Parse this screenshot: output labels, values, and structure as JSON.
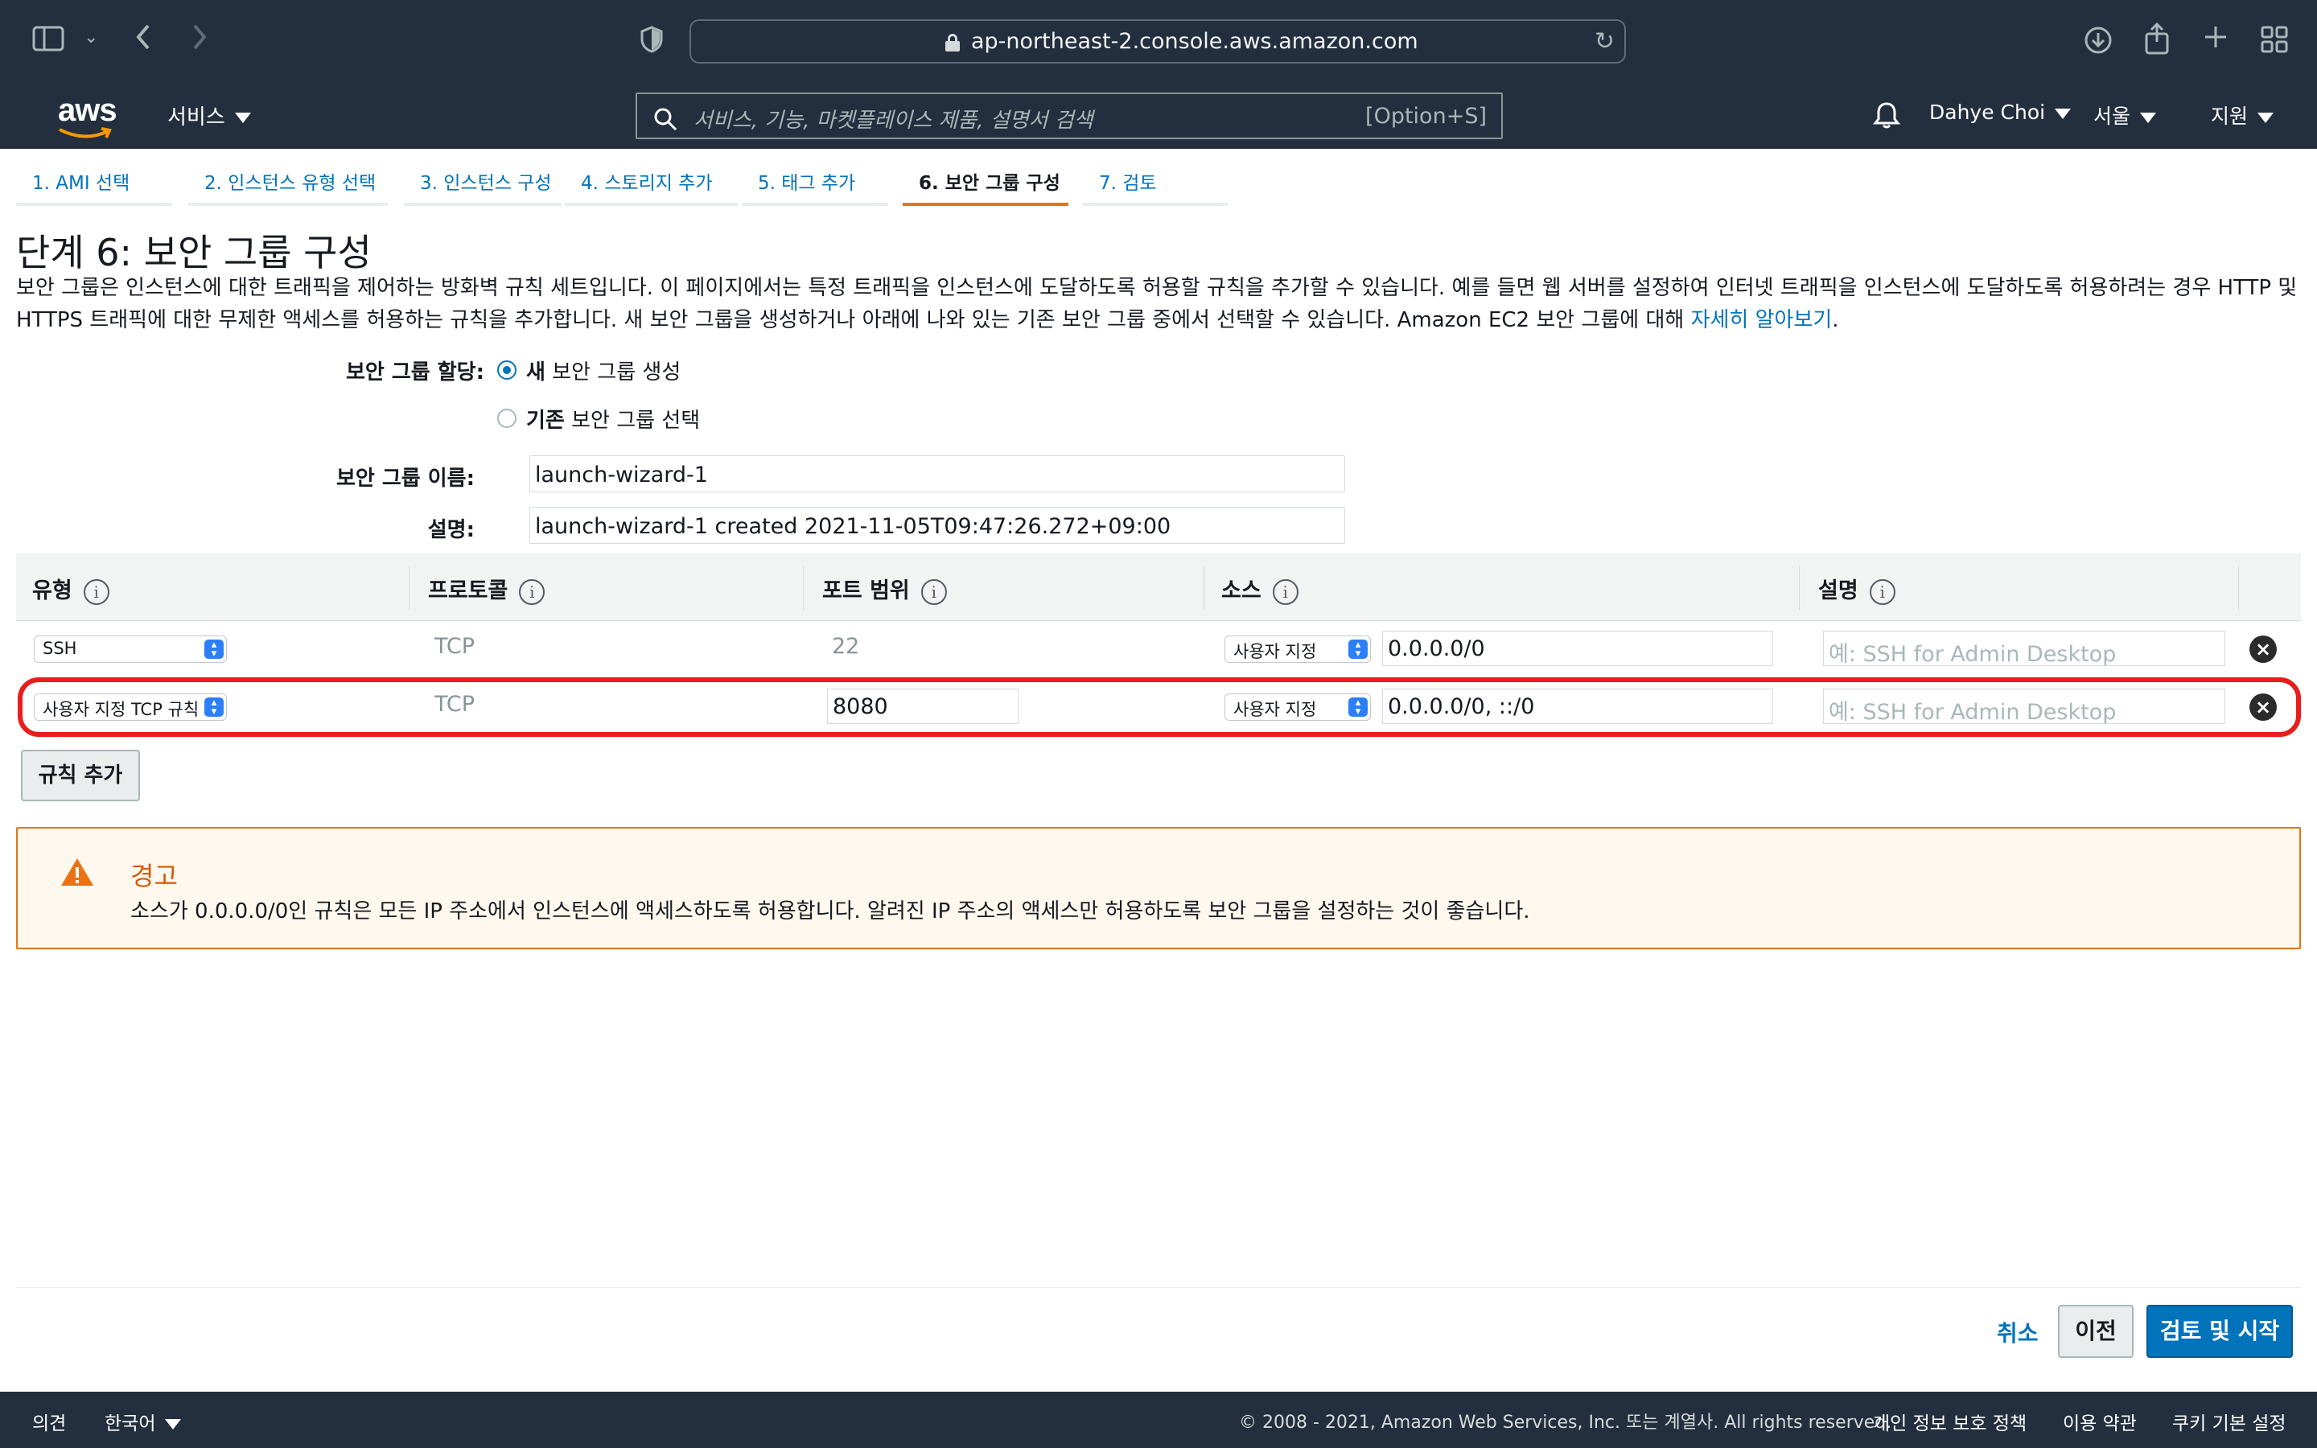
{
  "browser": {
    "url": "ap-northeast-2.console.aws.amazon.com"
  },
  "nav": {
    "logo": "aws",
    "services": "서비스",
    "search_placeholder": "서비스, 기능, 마켓플레이스 제품, 설명서 검색",
    "search_shortcut": "[Option+S]",
    "user": "Dahye Choi",
    "region": "서울",
    "support": "지원"
  },
  "steps": [
    {
      "label": "1. AMI 선택"
    },
    {
      "label": "2. 인스턴스 유형 선택"
    },
    {
      "label": "3. 인스턴스 구성"
    },
    {
      "label": "4. 스토리지 추가"
    },
    {
      "label": "5. 태그 추가"
    },
    {
      "label": "6. 보안 그룹 구성",
      "active": true
    },
    {
      "label": "7. 검토"
    }
  ],
  "page": {
    "title": "단계 6: 보안 그룹 구성",
    "intro": "보안 그룹은 인스턴스에 대한 트래픽을 제어하는 방화벽 규칙 세트입니다. 이 페이지에서는 특정 트래픽을 인스턴스에 도달하도록 허용할 규칙을 추가할 수 있습니다. 예를 들면 웹 서버를 설정하여 인터넷 트래픽을 인스턴스에 도달하도록 허용하려는 경우 HTTP 및 HTTPS 트래픽에 대한 무제한 액세스를 허용하는 규칙을 추가합니다. 새 보안 그룹을 생성하거나 아래에 나와 있는 기존 보안 그룹 중에서 선택할 수 있습니다. Amazon EC2 보안 그룹에 대해 ",
    "intro_link": "자세히 알아보기",
    "intro_end": "."
  },
  "form": {
    "assign_label": "보안 그룹 할당:",
    "option_new_bold": "새",
    "option_new_rest": " 보안 그룹 생성",
    "option_existing_bold": "기존",
    "option_existing_rest": " 보안 그룹 선택",
    "name_label": "보안 그룹 이름:",
    "name_value": "launch-wizard-1",
    "desc_label": "설명:",
    "desc_value": "launch-wizard-1 created 2021-11-05T09:47:26.272+09:00"
  },
  "table": {
    "headers": [
      "유형",
      "프로토콜",
      "포트 범위",
      "소스",
      "설명"
    ],
    "rows": [
      {
        "type": "SSH",
        "protocol": "TCP",
        "port": "22",
        "source_mode": "사용자 지정",
        "source": "0.0.0.0/0",
        "desc_placeholder": "예: SSH for Admin Desktop"
      },
      {
        "type": "사용자 지정 TCP 규칙",
        "protocol": "TCP",
        "port": "8080",
        "source_mode": "사용자 지정",
        "source": "0.0.0.0/0, ::/0",
        "desc_placeholder": "예: SSH for Admin Desktop"
      }
    ],
    "add_rule": "규칙 추가"
  },
  "warning": {
    "title": "경고",
    "body": "소스가 0.0.0.0/0인 규칙은 모든 IP 주소에서 인스턴스에 액세스하도록 허용합니다. 알려진 IP 주소의 액세스만 허용하도록 보안 그룹을 설정하는 것이 좋습니다."
  },
  "actions": {
    "cancel": "취소",
    "previous": "이전",
    "review_launch": "검토 및 시작"
  },
  "footer": {
    "feedback": "의견",
    "language": "한국어",
    "copyright": "© 2008 - 2021, Amazon Web Services, Inc. 또는 계열사. All rights reserved.",
    "privacy": "개인 정보 보호 정책",
    "terms": "이용 약관",
    "cookies": "쿠키 기본 설정"
  },
  "colors": {
    "nav_bg": "#232f3e",
    "link": "#0073bb",
    "active_tab": "#ec7211",
    "warning": "#d45b07",
    "highlight": "#e81d1d"
  }
}
